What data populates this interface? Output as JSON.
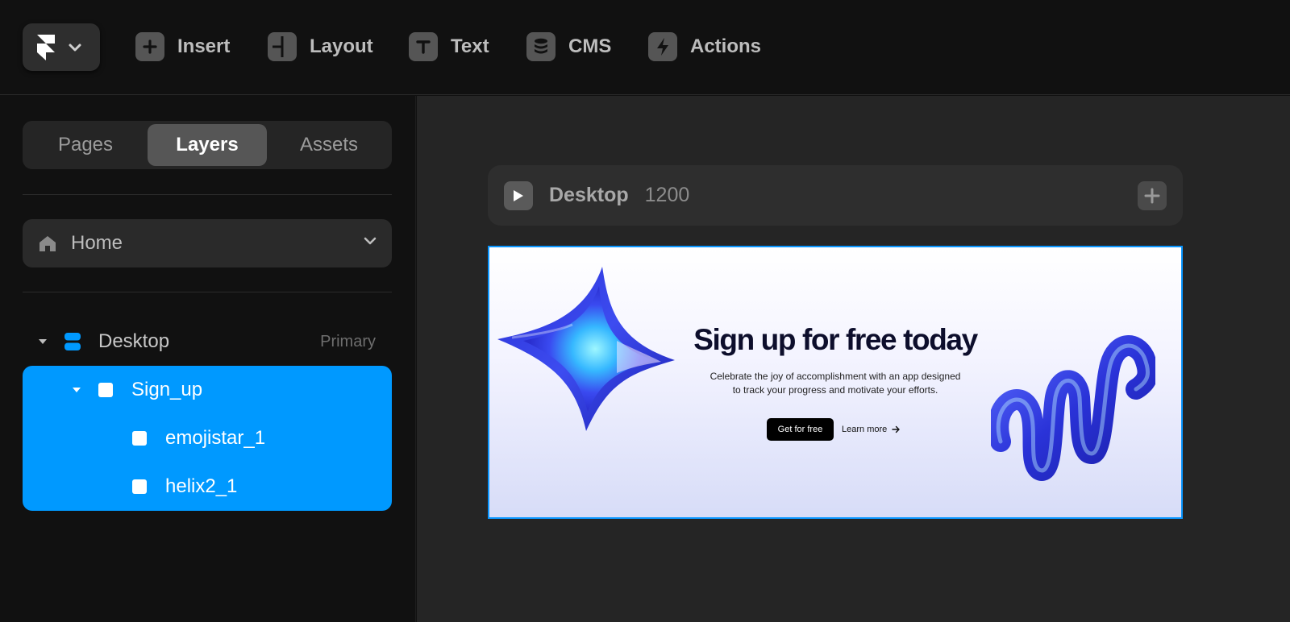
{
  "toolbar": {
    "items": [
      {
        "label": "Insert",
        "icon": "plus-icon"
      },
      {
        "label": "Layout",
        "icon": "layout-icon"
      },
      {
        "label": "Text",
        "icon": "text-icon"
      },
      {
        "label": "CMS",
        "icon": "database-icon"
      },
      {
        "label": "Actions",
        "icon": "lightning-icon"
      }
    ]
  },
  "left_panel": {
    "tabs": [
      {
        "label": "Pages",
        "active": false
      },
      {
        "label": "Layers",
        "active": true
      },
      {
        "label": "Assets",
        "active": false
      }
    ],
    "page_select": {
      "value": "Home",
      "icon": "home-icon"
    },
    "layers": {
      "desktop": {
        "name": "Desktop",
        "tag": "Primary"
      },
      "sign_up": {
        "name": "Sign_up"
      },
      "children": [
        {
          "name": "emojistar_1"
        },
        {
          "name": "helix2_1"
        }
      ]
    }
  },
  "canvas": {
    "frame_header": {
      "name": "Desktop",
      "width": "1200"
    },
    "hero": {
      "title": "Sign up for free today",
      "subtitle_line1": "Celebrate the joy of accomplishment with an app designed",
      "subtitle_line2": "to track your progress and motivate your efforts.",
      "cta": "Get for free",
      "link": "Learn more"
    }
  },
  "colors": {
    "accent": "#0099ff",
    "background": "#111111",
    "canvas": "#252525"
  }
}
